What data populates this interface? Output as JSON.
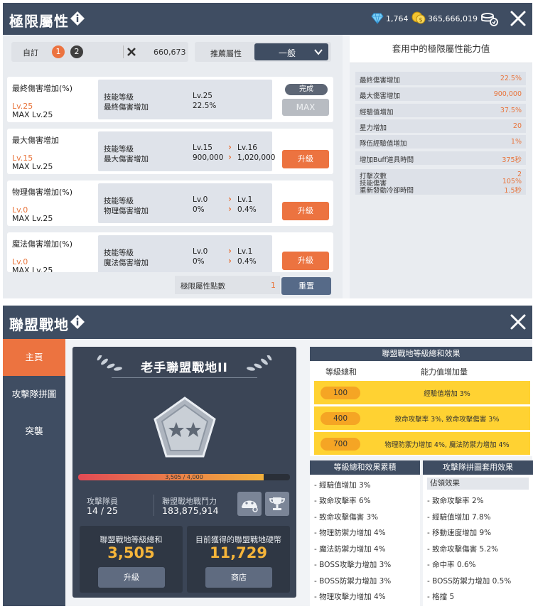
{
  "colors": {
    "accent": "#ec7340",
    "header": "#3f4d62",
    "value_orange": "#e8743b",
    "gold": "#f6b53a",
    "tier_yellow": "#ffd232"
  },
  "limit": {
    "title": "極限屬性",
    "currency": {
      "gem_count": "1,764",
      "coin_count": "365,666,019"
    },
    "preset": {
      "label": "自訂",
      "slot1": "1",
      "slot2": "2",
      "cost": "660,673"
    },
    "recommend": {
      "label": "推薦屬性",
      "value": "一般"
    },
    "skill_level_label": "技能等級",
    "cards": [
      {
        "name": "最終傷害增加(%)",
        "level": "Lv.25",
        "max": "MAX Lv.25",
        "stat": "最終傷害增加",
        "cur_lv": "Lv.25",
        "cur_val": "22.5%",
        "done_label": "完成",
        "max_label": "MAX"
      },
      {
        "name": "最大傷害增加",
        "level": "Lv.15",
        "max": "MAX Lv.25",
        "stat": "最大傷害增加",
        "cur_lv": "Lv.15",
        "cur_val": "900,000",
        "next_lv": "Lv.16",
        "next_val": "1,020,000",
        "btn": "升級"
      },
      {
        "name": "物理傷害增加(%)",
        "level": "Lv.0",
        "max": "MAX Lv.25",
        "stat": "物理傷害增加",
        "cur_lv": "Lv.0",
        "cur_val": "0%",
        "next_lv": "Lv.1",
        "next_val": "0.4%",
        "btn": "升級"
      },
      {
        "name": "魔法傷害增加(%)",
        "level": "Lv.0",
        "max": "MAX Lv.25",
        "stat": "魔法傷害增加",
        "cur_lv": "Lv.0",
        "cur_val": "0%",
        "next_lv": "Lv.1",
        "next_val": "0.4%",
        "btn": "升級"
      }
    ],
    "points": {
      "label": "極限屬性點數",
      "value": "1"
    },
    "reset_label": "重置",
    "applied_title": "套用中的極限屬性能力值",
    "stats": [
      {
        "k": "最終傷害增加",
        "v": "22.5%"
      },
      {
        "k": "最大傷害增加",
        "v": "900,000"
      },
      {
        "k": "經驗值增加",
        "v": "37.5%"
      },
      {
        "k": "星力增加",
        "v": "20"
      },
      {
        "k": "隊伍經驗值增加",
        "v": "1%"
      },
      {
        "k": "增加Buff道具時間",
        "v": "375秒"
      }
    ],
    "multi_stat": {
      "k1": "打擊次數",
      "k2": "技能傷害",
      "k3": "重新發動冷卻時間",
      "v1": "2",
      "v2": "105%",
      "v3": "1.5秒"
    }
  },
  "union": {
    "title": "聯盟戰地",
    "sidebar": [
      "主頁",
      "攻擊隊拼圖",
      "突襲"
    ],
    "rank_name": "老手聯盟戰地II",
    "exp_text": "3,505 / 4,000",
    "exp_progress": 0.876,
    "members_label": "攻擊隊員",
    "members_value": "14 / 25",
    "power_label": "聯盟戰地戰鬥力",
    "power_value": "183,875,914",
    "level_sum_label": "聯盟戰地等級總和",
    "level_sum_value": "3,505",
    "upgrade_label": "升級",
    "coin_label": "目前獲得的聯盟戰地硬幣",
    "coin_value": "11,729",
    "shop_label": "商店",
    "level_box": {
      "title": "聯盟戰地等級總和效果",
      "col1": "等級總和",
      "col2": "能力值增加量",
      "rows": [
        {
          "lv": "100",
          "eff": "經驗值增加 3%"
        },
        {
          "lv": "400",
          "eff": "致命攻擊率 3%, 致命攻擊傷害 3%"
        },
        {
          "lv": "700",
          "eff": "物理防禦力增加 4%, 魔法防禦力增加 4%"
        }
      ]
    },
    "accum": {
      "title": "等級總和效果累積",
      "items": [
        "- 經驗值增加 3%",
        "- 致命攻擊率 6%",
        "- 致命攻擊傷害 3%",
        "- 物理防禦力增加 4%",
        "- 魔法防禦力增加 4%",
        "- BOSS攻擊力增加 3%",
        "- BOSS防禦力增加 3%",
        "- 物理攻擊力增加 4%"
      ]
    },
    "puzzle": {
      "title": "攻擊隊拼圖套用效果",
      "sub": "佔領效果",
      "items": [
        "- 致命攻擊率 2%",
        "- 經驗值增加 7.8%",
        "- 移動速度增加 9%",
        "- 致命攻擊傷害 5.2%",
        "- 命中率 0.6%",
        "- BOSS防禦力增加 0.5%",
        "- 格擋 5"
      ]
    }
  }
}
